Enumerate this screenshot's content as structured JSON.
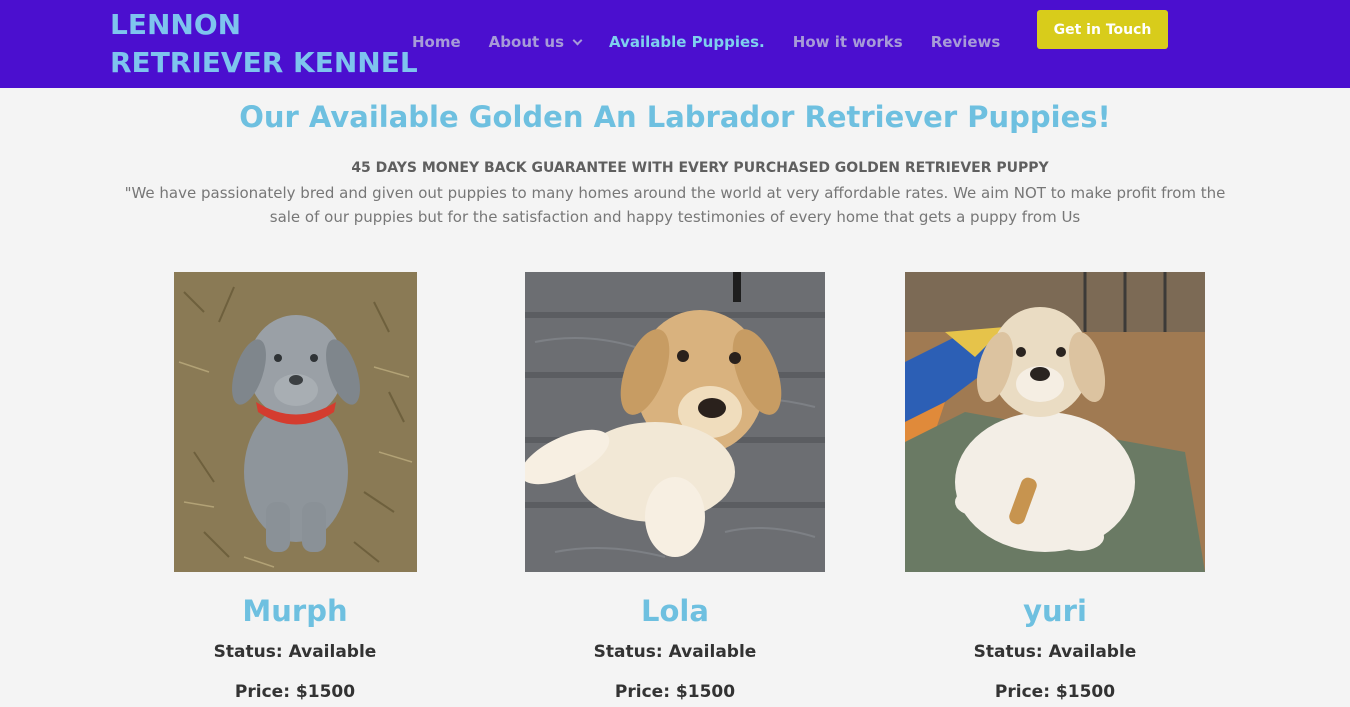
{
  "header": {
    "logo_line1": "LENNON",
    "logo_line2": "RETRIEVER KENNEL",
    "nav": [
      "Home",
      "About us",
      "Available Puppies.",
      "How it works",
      "Reviews"
    ],
    "cta_label": "Get in Touch",
    "background_color": "#4b0fcf",
    "cta_color": "#d8cc1b"
  },
  "main": {
    "title": "Our Available Golden An Labrador Retriever Puppies!",
    "guarantee": "45 DAYS MONEY BACK GUARANTEE WITH EVERY PURCHASED  GOLDEN RETRIEVER PUPPY",
    "description": "\"We have passionately bred and given out puppies to many homes around the world at very affordable rates. We aim NOT to make profit from the sale of our puppies but for the satisfaction and happy testimonies of every home that gets a puppy from Us"
  },
  "puppies": [
    {
      "name": "Murph",
      "status": "Status: Available",
      "price": "Price: $1500"
    },
    {
      "name": "Lola",
      "status": "Status: Available",
      "price": "Price: $1500"
    },
    {
      "name": "yuri",
      "status": "Status: Available",
      "price": "Price: $1500"
    }
  ]
}
